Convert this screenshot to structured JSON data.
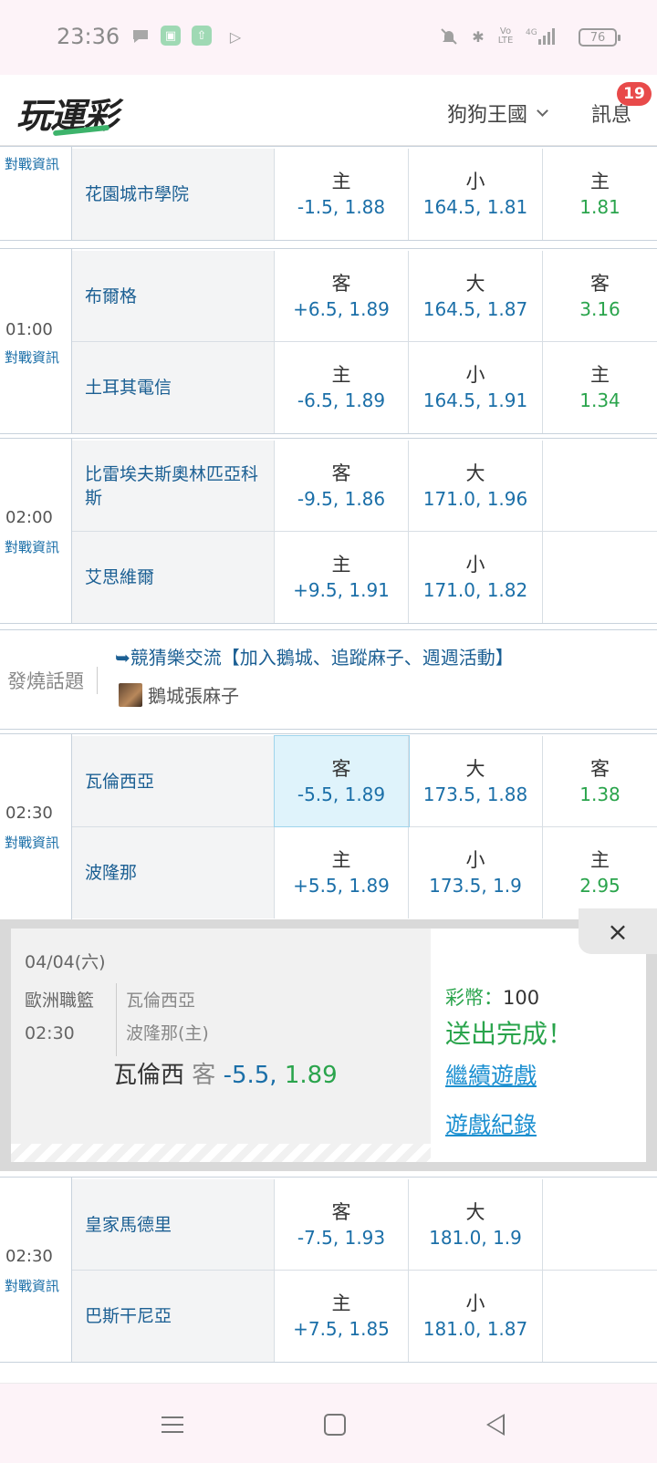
{
  "status_bar": {
    "time": "23:36",
    "battery": "76",
    "signal_label": "4G",
    "volte_label": "Vo LTE",
    "notification_icons": [
      "chat-bubble-icon",
      "android-app-icon",
      "upload-app-icon",
      "play-store-icon"
    ],
    "system_icons": [
      "mute-bell-icon",
      "bluetooth-icon",
      "volte-icon",
      "signal-icon",
      "battery-icon"
    ]
  },
  "header": {
    "logo": "玩運彩",
    "user_menu": "狗狗王國",
    "messages_label": "訊息",
    "messages_badge": "19"
  },
  "games": [
    {
      "time": "",
      "info_link": "對戰資訊",
      "teams": [
        {
          "name": "花園城市學院",
          "c1_label": "主",
          "c1_value": "-1.5, 1.88",
          "c2_label": "小",
          "c2_value": "164.5, 1.81",
          "c3_label": "主",
          "c3_value": "1.81"
        }
      ]
    },
    {
      "time": "01:00",
      "info_link": "對戰資訊",
      "teams": [
        {
          "name": "布爾格",
          "c1_label": "客",
          "c1_value": "+6.5, 1.89",
          "c2_label": "大",
          "c2_value": "164.5, 1.87",
          "c3_label": "客",
          "c3_value": "3.16"
        },
        {
          "name": "土耳其電信",
          "c1_label": "主",
          "c1_value": "-6.5, 1.89",
          "c2_label": "小",
          "c2_value": "164.5, 1.91",
          "c3_label": "主",
          "c3_value": "1.34"
        }
      ]
    },
    {
      "time": "02:00",
      "info_link": "對戰資訊",
      "teams": [
        {
          "name": "比雷埃夫斯奧林匹亞科斯",
          "c1_label": "客",
          "c1_value": "-9.5, 1.86",
          "c2_label": "大",
          "c2_value": "171.0, 1.96",
          "c3_label": "",
          "c3_value": ""
        },
        {
          "name": "艾思維爾",
          "c1_label": "主",
          "c1_value": "+9.5, 1.91",
          "c2_label": "小",
          "c2_value": "171.0, 1.82",
          "c3_label": "",
          "c3_value": ""
        }
      ]
    },
    {
      "time": "02:30",
      "info_link": "對戰資訊",
      "teams": [
        {
          "name": "瓦倫西亞",
          "c1_label": "客",
          "c1_value": "-5.5, 1.89",
          "c2_label": "大",
          "c2_value": "173.5, 1.88",
          "c3_label": "客",
          "c3_value": "1.38"
        },
        {
          "name": "波隆那",
          "c1_label": "主",
          "c1_value": "+5.5, 1.89",
          "c2_label": "小",
          "c2_value": "173.5, 1.9",
          "c3_label": "主",
          "c3_value": "2.95"
        }
      ]
    },
    {
      "time": "02:30",
      "info_link": "對戰資訊",
      "teams": [
        {
          "name": "皇家馬德里",
          "c1_label": "客",
          "c1_value": "-7.5, 1.93",
          "c2_label": "大",
          "c2_value": "181.0, 1.9",
          "c3_label": "",
          "c3_value": ""
        },
        {
          "name": "巴斯干尼亞",
          "c1_label": "主",
          "c1_value": "+7.5, 1.85",
          "c2_label": "小",
          "c2_value": "181.0, 1.87",
          "c3_label": "",
          "c3_value": ""
        }
      ]
    }
  ],
  "hot_topic": {
    "label": "發燒話題",
    "arrow": "➥",
    "title": "競猜樂交流【加入鵝城、追蹤麻子、週週活動】",
    "author": "鵝城張麻子"
  },
  "bet_popup": {
    "date": "04/04(六)",
    "league": "歐洲職籃",
    "time": "02:30",
    "home_team": "瓦倫西亞",
    "away_team": "波隆那(主)",
    "bet_team": "瓦倫西",
    "bet_side": "客",
    "bet_handicap": "-5.5,",
    "bet_odds": "1.89",
    "coins_label": "彩幣：",
    "coins_value": "100",
    "status": "送出完成！",
    "continue_link": "繼續遊戲",
    "history_link": "遊戲紀錄",
    "close": "×"
  },
  "colors": {
    "accent_green": "#2aa44c",
    "accent_blue": "#1b6fa8",
    "badge_red": "#e84a4a",
    "selected_cell": "#dff3fb"
  }
}
